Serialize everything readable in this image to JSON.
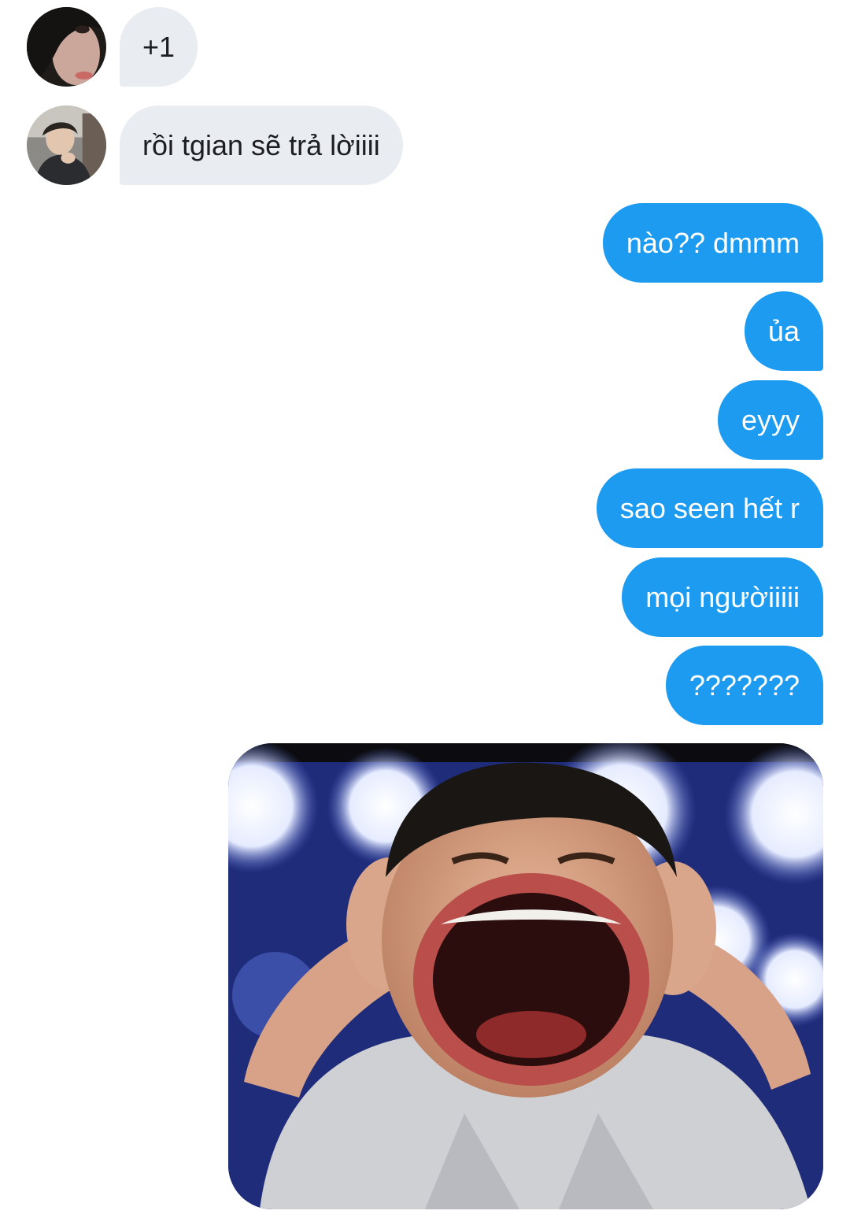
{
  "conversation": {
    "incoming": [
      {
        "text": "+1",
        "avatar": "avatar-dark-hood"
      },
      {
        "text": "rồi tgian sẽ trả lờiiii",
        "avatar": "avatar-boy-photo"
      }
    ],
    "outgoing": [
      {
        "text": "nào?? dmmm"
      },
      {
        "text": "ủa"
      },
      {
        "text": "eyyy"
      },
      {
        "text": "sao seen hết r"
      },
      {
        "text": "mọi ngườiiiii"
      },
      {
        "text": "???????"
      }
    ],
    "media": {
      "kind": "image",
      "subject": "screaming-man-meme"
    }
  },
  "colors": {
    "incoming_bubble": "#e9ecf0",
    "incoming_text": "#1c1e21",
    "outgoing_bubble": "#1d9bf0",
    "outgoing_text": "#ffffff",
    "background": "#ffffff"
  }
}
